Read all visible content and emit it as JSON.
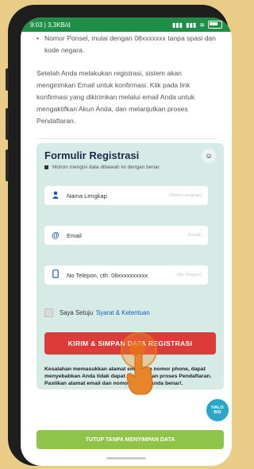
{
  "status": {
    "left_text": "9:03 | 3,3KB/d",
    "right_indicators": [
      "signal",
      "signal",
      "wifi",
      "battery"
    ]
  },
  "info": {
    "bullet_text": "Nomor Ponsel, mulai dengan 08xxxxxxx tanpa spasi dan kode negara.",
    "paragraph": "Setelah Anda melakukan registrasi, sistem akan mengirimkan Email untuk konfirmasi. Klik pada link konfirmasi yang dikirimkan melalui email Anda untuk mengaktifkan Akun Anda, dan melanjutkan proses Pendaftaran."
  },
  "form": {
    "title": "Formulir Registrasi",
    "subtitle": "Mohon mengisi data dibawah ini dengan benar.",
    "fields": [
      {
        "label": "Nama Lengkap",
        "hint": "(Nama Lengkap)",
        "icon": "user-icon"
      },
      {
        "label": "Email",
        "hint": "(Email)",
        "icon": "at-icon"
      },
      {
        "label": "No Telepon, cth: 08xxxxxxxxxx",
        "hint": "(No Telepon)",
        "icon": "phone-icon"
      }
    ],
    "agree_text": "Saya Setuju",
    "agree_link": "Syarat & Ketentuan",
    "submit_label": "KIRIM & SIMPAN DATA REGISTRASI",
    "warning": "Kesalahan memasukkan alamat email dan nomor phone, dapat menyebabkan Anda tidak dapat melanjutkan proses Pendaftaran. Pastikan alamat email dan nomor ponsel Anda benar!."
  },
  "chat_badge": {
    "line1": "HALO",
    "line2": "BSI"
  },
  "footer_button": "TUTUP TANPA MENYIMPAN DATA",
  "colors": {
    "status_bar": "#1f8f47",
    "form_bg": "#d6eae6",
    "submit_bg": "#dd3a3a",
    "footer_bg": "#8dc449",
    "link": "#1a60c0",
    "chat_badge": "#2aa6c6"
  }
}
